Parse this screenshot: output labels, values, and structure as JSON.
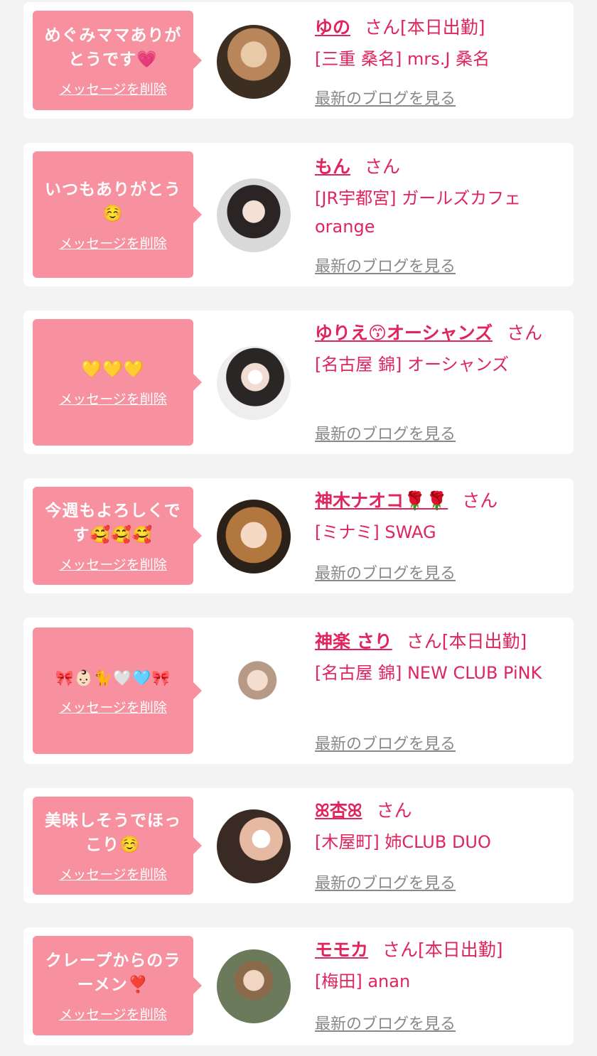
{
  "delete_label": "メッセージを削除",
  "san_label": "さん",
  "blog_label": "最新のブログを見る",
  "colors": {
    "bubble": "#f7909f",
    "name": "#e0245e",
    "link_gray": "#888888"
  },
  "cards": [
    {
      "message": "めぐみママありがとうです💗",
      "name": "ゆの",
      "tag": "[本日出勤]",
      "shop": "[三重 桑名] mrs.J 桑名"
    },
    {
      "message": "いつもありがとう☺️",
      "name": "もん",
      "tag": "",
      "shop": "[JR宇都宮] ガールズカフェorange"
    },
    {
      "message": "💛💛💛",
      "name": "ゆりえ😙オーシャンズ",
      "tag": "",
      "shop": "[名古屋 錦] オーシャンズ"
    },
    {
      "message": "今週もよろしくです🥰🥰🥰",
      "name": "神木ナオコ🌹🌹",
      "tag": "",
      "shop": "[ミナミ] SWAG"
    },
    {
      "message": "🎀👶🏻🐈🤍🩵🎀",
      "name": "神楽 さり",
      "tag": "[本日出勤]",
      "shop": "[名古屋 錦] NEW CLUB PiNK"
    },
    {
      "message": "美味しそうでほっこり☺️",
      "name": "ꕤ杏ꕤ",
      "tag": "",
      "shop": "[木屋町] 姉CLUB DUO"
    },
    {
      "message": "クレープからのラーメン❣️",
      "name": "モモカ",
      "tag": "[本日出勤]",
      "shop": "[梅田] anan"
    }
  ]
}
